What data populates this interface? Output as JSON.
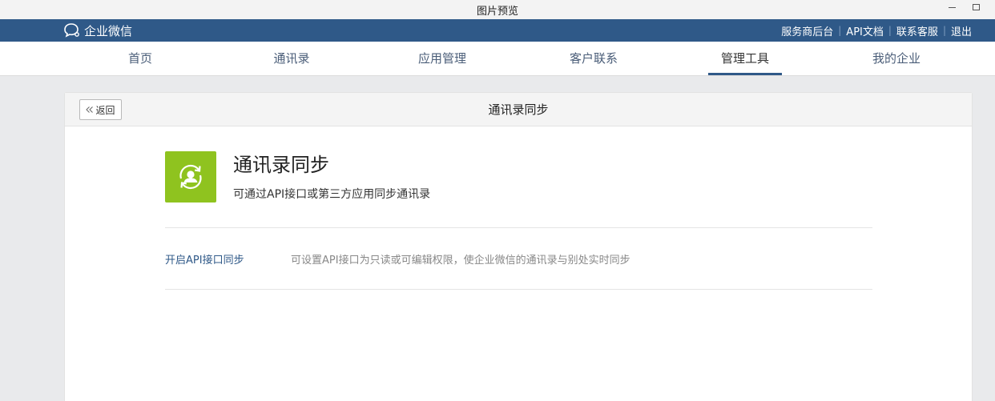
{
  "window": {
    "title": "图片预览"
  },
  "topbar": {
    "brand": "企业微信",
    "links": [
      "服务商后台",
      "API文档",
      "联系客服",
      "退出"
    ]
  },
  "nav": {
    "items": [
      "首页",
      "通讯录",
      "应用管理",
      "客户联系",
      "管理工具",
      "我的企业"
    ],
    "active": "管理工具"
  },
  "panel": {
    "back_label": "返回",
    "title": "通讯录同步",
    "app_name": "通讯录同步",
    "app_desc": "可通过API接口或第三方应用同步通讯录",
    "option_label": "开启API接口同步",
    "option_desc": "可设置API接口为只读或可编辑权限，使企业微信的通讯录与别处实时同步"
  },
  "colors": {
    "topbar": "#2f5988",
    "app_icon": "#8fc31f",
    "link": "#2f5988"
  },
  "icons": {
    "brand": "chat-bubble-icon",
    "back": "double-chevron-left-icon",
    "app": "contact-sync-icon"
  }
}
